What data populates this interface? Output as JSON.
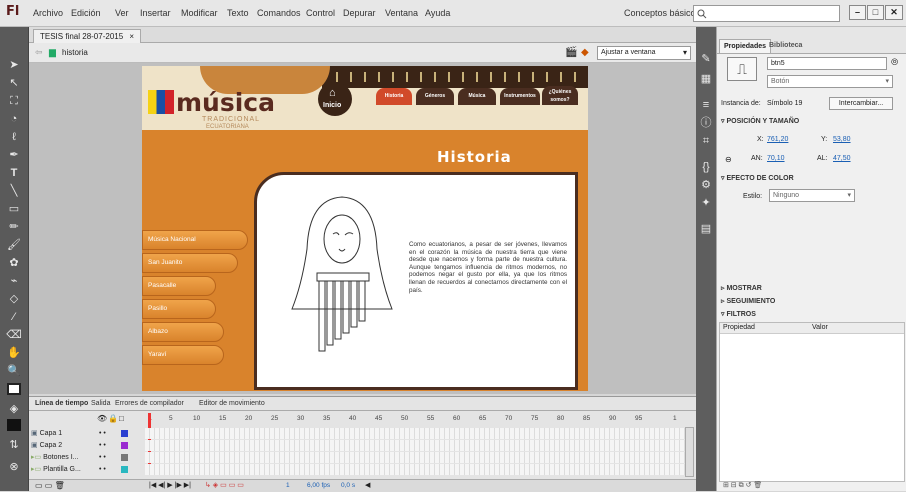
{
  "app": {
    "logo": "Fl",
    "menu": [
      "Archivo",
      "Edición",
      "Ver",
      "Insertar",
      "Modificar",
      "Texto",
      "Comandos",
      "Control",
      "Depurar",
      "Ventana",
      "Ayuda"
    ],
    "workspace": "Conceptos básicos",
    "window_buttons": [
      "–",
      "□",
      "✕"
    ]
  },
  "document": {
    "tab_label": "TESIS final 28-07-2015",
    "tab_close": "×",
    "scene": "historia",
    "zoom": "Ajustar a ventana"
  },
  "stage": {
    "brand": "música",
    "brand_sub1": "TRADICIONAL",
    "brand_sub2": "ECUATORIANA",
    "home": "Inicio",
    "nav": [
      "Historia",
      "Géneros",
      "Música",
      "Instrumentos",
      "¿Quiénes somos?"
    ],
    "page_title": "Historia",
    "side_menu": [
      "Música Nacional",
      "San Juanito",
      "Pasacalle",
      "Pasillo",
      "Albazo",
      "Yaraví"
    ],
    "body_text": "Como ecuatorianos, a pesar de ser jóvenes, llevamos en el corazón la música de nuestra tierra que viene desde que nacemos y forma parte de nuestra cultura. Aunque tengamos influencia de ritmos modernos, no podemos negar el gusto por ella, ya que los ritmos llenan de recuerdos al conectarnos directamente con el país."
  },
  "properties": {
    "tabs": [
      "Propiedades",
      "Biblioteca"
    ],
    "instance_name": "btn5",
    "symbol_type": "Botón",
    "instance_of_label": "Instancia de:",
    "instance_of": "Símbolo 19",
    "swap_button": "Intercambiar...",
    "section_position": "POSICIÓN Y TAMAÑO",
    "x_label": "X:",
    "x": "761,20",
    "y_label": "Y:",
    "y": "53,80",
    "w_label": "AN:",
    "w": "70,10",
    "h_label": "AL:",
    "h": "47,50",
    "section_color": "EFECTO DE COLOR",
    "style_label": "Estilo:",
    "style": "Ninguno",
    "section_display": "MOSTRAR",
    "section_tracking": "SEGUIMIENTO",
    "section_filters": "FILTROS",
    "filter_col_property": "Propiedad",
    "filter_col_value": "Valor"
  },
  "timeline": {
    "tabs": [
      "Línea de tiempo",
      "Salida",
      "Errores de compilador",
      "Editor de movimiento"
    ],
    "frame_numbers": [
      "1",
      "5",
      "10",
      "15",
      "20",
      "25",
      "30",
      "35",
      "40",
      "45",
      "50",
      "55",
      "60",
      "65",
      "70",
      "75",
      "80",
      "85",
      "90",
      "95",
      "1"
    ],
    "layers": [
      "Capa 1",
      "Capa 2",
      "Botones I...",
      "Plantilla G..."
    ],
    "fps": "6,00 fps",
    "time": "0,0 s",
    "current_frame": "1"
  }
}
